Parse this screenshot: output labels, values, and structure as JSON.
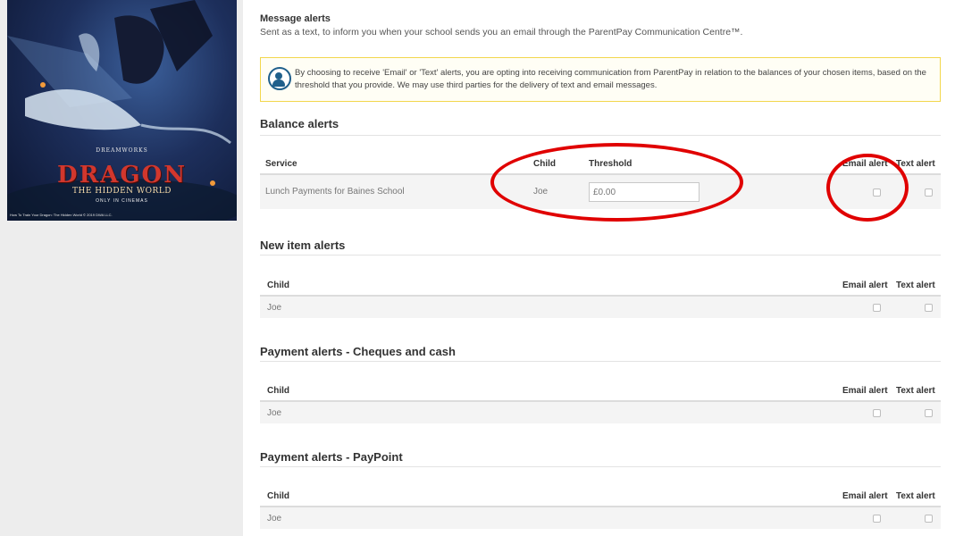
{
  "ad": {
    "brand": "DREAMWORKS",
    "title": "DRAGON",
    "subtitle": "THE HIDDEN WORLD",
    "tagline": "ONLY IN CINEMAS",
    "credit": "How To Train Your Dragon: The Hidden World © 2019 DWA LLC."
  },
  "message_alerts": {
    "title": "Message alerts",
    "description": "Sent as a text, to inform you when your school sends you an email through the ParentPay Communication Centre™."
  },
  "notice": {
    "text": "By choosing to receive 'Email' or 'Text' alerts, you are opting into receiving communication from ParentPay in relation to the balances of your chosen items, based on the threshold that you provide. We may use third parties for the delivery of text and email messages."
  },
  "balance_alerts": {
    "title": "Balance alerts",
    "headers": {
      "service": "Service",
      "child": "Child",
      "threshold": "Threshold",
      "email": "Email alert",
      "text": "Text alert"
    },
    "rows": [
      {
        "service": "Lunch Payments for Baines School",
        "child": "Joe",
        "threshold": "£0.00",
        "email_checked": false,
        "text_checked": false
      }
    ]
  },
  "new_item_alerts": {
    "title": "New item alerts",
    "headers": {
      "child": "Child",
      "email": "Email alert",
      "text": "Text alert"
    },
    "rows": [
      {
        "child": "Joe",
        "email_checked": false,
        "text_checked": false
      }
    ]
  },
  "cheques_alerts": {
    "title": "Payment alerts - Cheques and cash",
    "headers": {
      "child": "Child",
      "email": "Email alert",
      "text": "Text alert"
    },
    "rows": [
      {
        "child": "Joe",
        "email_checked": false,
        "text_checked": false
      }
    ]
  },
  "paypoint_alerts": {
    "title": "Payment alerts - PayPoint",
    "headers": {
      "child": "Child",
      "email": "Email alert",
      "text": "Text alert"
    },
    "rows": [
      {
        "child": "Joe",
        "email_checked": false,
        "text_checked": false
      }
    ]
  },
  "colors": {
    "accent_yellow": "#f2d74d",
    "icon_blue": "#1f5f8b",
    "annotation_red": "#e00000"
  }
}
